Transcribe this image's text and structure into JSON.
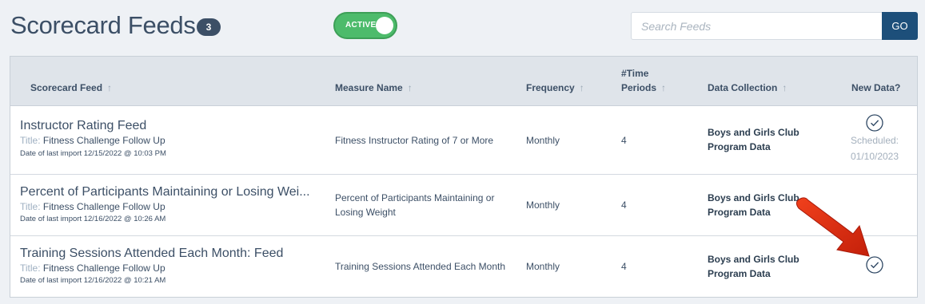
{
  "header": {
    "title": "Scorecard Feeds",
    "count": "3",
    "toggle_label": "ACTIVE",
    "search_placeholder": "Search Feeds",
    "go_label": "GO"
  },
  "table": {
    "columns": [
      {
        "label": "Scorecard Feed",
        "sortable": true
      },
      {
        "label": "Measure Name",
        "sortable": true
      },
      {
        "label": "Frequency",
        "sortable": true
      },
      {
        "label": "#Time",
        "label2": "Periods",
        "sortable": true
      },
      {
        "label": "Data Collection",
        "sortable": true
      },
      {
        "label": "New Data?",
        "sortable": false
      }
    ],
    "sort_arrow": "↑",
    "title_prefix": "Title:",
    "rows": [
      {
        "name": "Instructor Rating Feed",
        "title": "Fitness Challenge Follow Up",
        "last_import": "Date of last import 12/15/2022 @ 10:03 PM",
        "measure": "Fitness Instructor Rating of 7 or More",
        "measure2": "",
        "frequency": "Monthly",
        "periods": "4",
        "collection": "Boys and Girls Club",
        "collection2": "Program Data",
        "new_data_check": true,
        "scheduled_label": "Scheduled:",
        "scheduled_date": "01/10/2023"
      },
      {
        "name": "Percent of Participants Maintaining or Losing Wei...",
        "title": "Fitness Challenge Follow Up",
        "last_import": "Date of last import 12/16/2022 @ 10:26 AM",
        "measure": "Percent of Participants Maintaining or",
        "measure2": "Losing Weight",
        "frequency": "Monthly",
        "periods": "4",
        "collection": "Boys and Girls Club",
        "collection2": "Program Data",
        "new_data_check": false
      },
      {
        "name": "Training Sessions Attended Each Month: Feed",
        "title": "Fitness Challenge Follow Up",
        "last_import": "Date of last import 12/16/2022 @ 10:21 AM",
        "measure": "Training Sessions Attended Each Month",
        "measure2": "",
        "frequency": "Monthly",
        "periods": "4",
        "collection": "Boys and Girls Club",
        "collection2": "Program Data",
        "new_data_check": true
      }
    ]
  },
  "colors": {
    "accent": "#1d4f7a",
    "toggle_on": "#4dbb6b",
    "annotation_arrow": "#e02b12"
  }
}
